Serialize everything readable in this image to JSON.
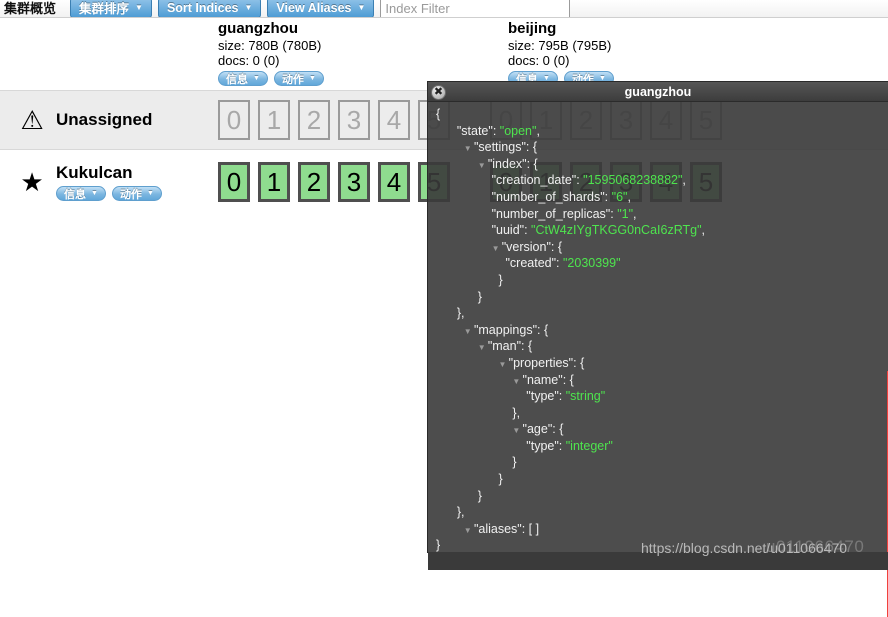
{
  "toolbar": {
    "title": "集群概览",
    "buttons": [
      {
        "label": "集群排序",
        "caret": "▼",
        "icon": "chevron-down-icon"
      },
      {
        "label": "Sort Indices",
        "caret": "▼",
        "icon": "chevron-down-icon"
      },
      {
        "label": "View Aliases",
        "caret": "▼",
        "icon": "chevron-down-icon"
      }
    ],
    "filter": {
      "value": "",
      "placeholder": "Index Filter"
    }
  },
  "indices": [
    {
      "name": "guangzhou",
      "size": "size: 780B (780B)",
      "docs": "docs: 0 (0)",
      "info_label": "信息",
      "action_label": "动作",
      "caret": "▼"
    },
    {
      "name": "beijing",
      "size": "size: 795B (795B)",
      "docs": "docs: 0 (0)",
      "info_label": "信息",
      "action_label": "动作",
      "caret": "▼"
    }
  ],
  "nodes": [
    {
      "name": "Unassigned",
      "icon": "warning-triangle-icon",
      "glyph": "⚠",
      "shards_guangzhou": [
        "0",
        "1",
        "2",
        "3",
        "4",
        "5"
      ],
      "shards_beijing": [
        "0",
        "1",
        "2",
        "3",
        "4",
        "5"
      ],
      "state": "unassigned"
    },
    {
      "name": "Kukulcan",
      "icon": "star-icon",
      "glyph": "★",
      "info_label": "信息",
      "action_label": "动作",
      "caret": "▼",
      "shards_guangzhou": [
        "0",
        "1",
        "2",
        "3",
        "4",
        "5"
      ],
      "shards_beijing": [
        "0",
        "1",
        "2",
        "3",
        "4",
        "5"
      ],
      "state": "assigned"
    }
  ],
  "modal": {
    "title": "guangzhou",
    "close_glyph": "✖",
    "twisty": "▼",
    "json_lines": [
      {
        "indent": 0,
        "twisty": false,
        "text": "{"
      },
      {
        "indent": 3,
        "twisty": false,
        "key": "\"state\"",
        "sep": ": ",
        "val": "\"open\"",
        "tail": ","
      },
      {
        "indent": 4,
        "twisty": true,
        "key": "\"settings\"",
        "sep": ": ",
        "tail": "{"
      },
      {
        "indent": 6,
        "twisty": true,
        "key": "\"index\"",
        "sep": ": ",
        "tail": "{"
      },
      {
        "indent": 8,
        "twisty": false,
        "key": "\"creation_date\"",
        "sep": ": ",
        "val": "\"1595068238882\"",
        "tail": ","
      },
      {
        "indent": 8,
        "twisty": false,
        "key": "\"number_of_shards\"",
        "sep": ": ",
        "val": "\"6\"",
        "tail": ","
      },
      {
        "indent": 8,
        "twisty": false,
        "key": "\"number_of_replicas\"",
        "sep": ": ",
        "val": "\"1\"",
        "tail": ","
      },
      {
        "indent": 8,
        "twisty": false,
        "key": "\"uuid\"",
        "sep": ": ",
        "val": "\"CtW4zIYgTKGG0nCaI6zRTg\"",
        "tail": ","
      },
      {
        "indent": 8,
        "twisty": true,
        "key": "\"version\"",
        "sep": ": ",
        "tail": "{"
      },
      {
        "indent": 10,
        "twisty": false,
        "key": "\"created\"",
        "sep": ": ",
        "val": "\"2030399\"",
        "tail": ""
      },
      {
        "indent": 9,
        "twisty": false,
        "text": "}"
      },
      {
        "indent": 6,
        "twisty": false,
        "text": "}"
      },
      {
        "indent": 3,
        "twisty": false,
        "text": "},"
      },
      {
        "indent": 4,
        "twisty": true,
        "key": "\"mappings\"",
        "sep": ": ",
        "tail": "{"
      },
      {
        "indent": 6,
        "twisty": true,
        "key": "\"man\"",
        "sep": ": ",
        "tail": "{"
      },
      {
        "indent": 9,
        "twisty": true,
        "key": "\"properties\"",
        "sep": ": ",
        "tail": "{"
      },
      {
        "indent": 11,
        "twisty": true,
        "key": "\"name\"",
        "sep": ": ",
        "tail": "{"
      },
      {
        "indent": 13,
        "twisty": false,
        "key": "\"type\"",
        "sep": ": ",
        "val": "\"string\"",
        "tail": ""
      },
      {
        "indent": 11,
        "twisty": false,
        "text": "},"
      },
      {
        "indent": 11,
        "twisty": true,
        "key": "\"age\"",
        "sep": ": ",
        "tail": "{"
      },
      {
        "indent": 13,
        "twisty": false,
        "key": "\"type\"",
        "sep": ": ",
        "val": "\"integer\"",
        "tail": ""
      },
      {
        "indent": 11,
        "twisty": false,
        "text": "}"
      },
      {
        "indent": 9,
        "twisty": false,
        "text": "}"
      },
      {
        "indent": 6,
        "twisty": false,
        "text": "}"
      },
      {
        "indent": 3,
        "twisty": false,
        "text": "},"
      },
      {
        "indent": 4,
        "twisty": true,
        "key": "\"aliases\"",
        "sep": ": ",
        "tail": "[ ]"
      },
      {
        "indent": 0,
        "twisty": false,
        "text": "}"
      }
    ]
  },
  "annotation": {
    "name": "mappings-highlight",
    "color": "#f0413c"
  },
  "watermark": {
    "text": "https://blog.csdn.net/u011066470",
    "ghost": "u011066470"
  },
  "colors": {
    "toolbar_button": "#4e9cd4",
    "shard_assigned": "#8fdc8f",
    "shard_unassigned_border": "#9a9a9a",
    "modal_bg": "#3a3a3a",
    "json_string": "#4ee44e",
    "annotation_red": "#f0413c"
  }
}
